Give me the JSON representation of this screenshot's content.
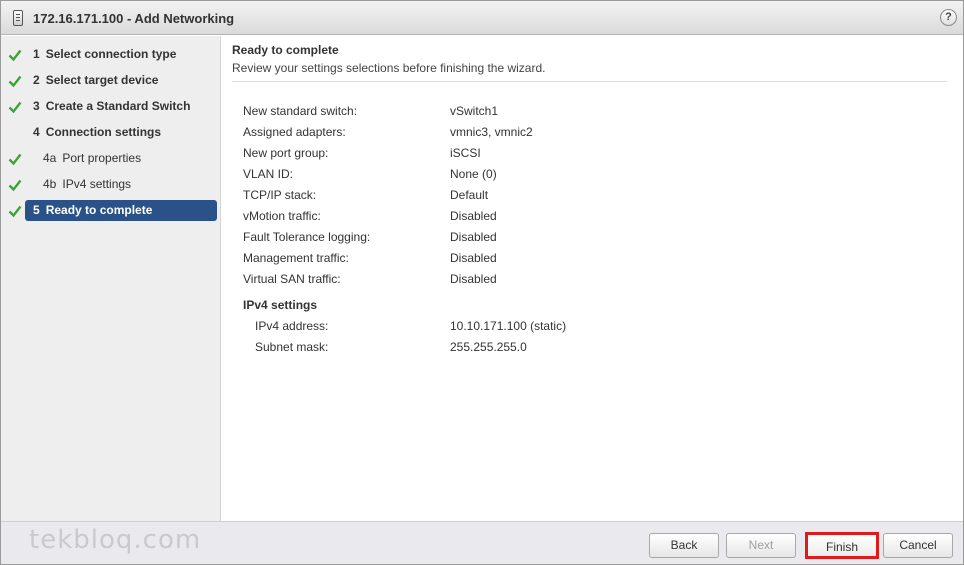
{
  "window": {
    "title": "172.16.171.100 - Add Networking",
    "help_label": "?"
  },
  "sidebar": {
    "steps": [
      {
        "num": "1",
        "label": "Select connection type",
        "completed": true
      },
      {
        "num": "2",
        "label": "Select target device",
        "completed": true
      },
      {
        "num": "3",
        "label": "Create a Standard Switch",
        "completed": true
      },
      {
        "num": "4",
        "label": "Connection settings",
        "completed": false
      },
      {
        "num": "4a",
        "label": "Port properties",
        "completed": true
      },
      {
        "num": "4b",
        "label": "IPv4 settings",
        "completed": true
      },
      {
        "num": "5",
        "label": "Ready to complete",
        "completed": true,
        "active": true
      }
    ]
  },
  "main": {
    "title": "Ready to complete",
    "subtitle": "Review your settings selections before finishing the wizard.",
    "settings": [
      {
        "key": "New standard switch:",
        "value": "vSwitch1"
      },
      {
        "key": "Assigned adapters:",
        "value": "vmnic3, vmnic2"
      },
      {
        "key": "New port group:",
        "value": "iSCSI"
      },
      {
        "key": "VLAN ID:",
        "value": "None (0)"
      },
      {
        "key": "TCP/IP stack:",
        "value": "Default"
      },
      {
        "key": "vMotion traffic:",
        "value": "Disabled"
      },
      {
        "key": "Fault Tolerance logging:",
        "value": "Disabled"
      },
      {
        "key": "Management traffic:",
        "value": "Disabled"
      },
      {
        "key": "Virtual SAN traffic:",
        "value": "Disabled"
      }
    ],
    "ipv4_heading": "IPv4 settings",
    "ipv4": [
      {
        "key": "IPv4 address:",
        "value": "10.10.171.100 (static)"
      },
      {
        "key": "Subnet mask:",
        "value": "255.255.255.0"
      }
    ]
  },
  "footer": {
    "watermark": "tekbloq.com",
    "back_label": "Back",
    "next_label": "Next",
    "finish_label": "Finish",
    "cancel_label": "Cancel"
  },
  "colors": {
    "active_step_bg": "#2b5288",
    "check_green": "#3aa535",
    "finish_highlight": "#e0191d"
  },
  "icons": {
    "title": "vm-host-icon",
    "help": "help-icon",
    "completed_step": "checkmark-icon"
  }
}
